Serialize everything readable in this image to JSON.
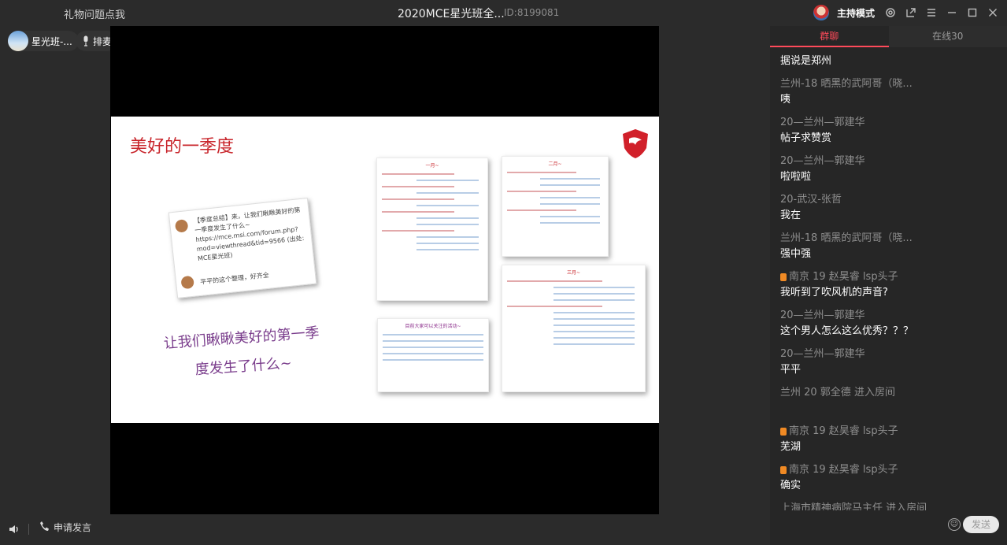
{
  "titlebar": {
    "gift_link": "礼物问题点我",
    "title": "2020MCE星光班全...",
    "room_id": "ID:8199081",
    "host_mode": "主持模式"
  },
  "stage": {
    "owner_name": "星光班-...",
    "mic_label": "排麦",
    "apply_label": "申请发言"
  },
  "slide": {
    "title": "美好的一季度",
    "note_text": "【季度总结】来，让我们瞅瞅美好的第一季度发生了什么~ https://mce.msi.com/forum.php?mod=viewthread&tid=9566 (出处: MCE星光班)",
    "note_sign": "平平的这个整理，好齐全",
    "purple_text": "让我们瞅瞅美好的第一季度发生了什么~",
    "card_month1": "一月~",
    "card_month2": "二月~",
    "card_month3": "三月~",
    "card_events": "目前大家可以关注的活动~"
  },
  "panel": {
    "tab_chat": "群聊",
    "tab_online": "在线30",
    "messages": [
      {
        "user": "",
        "text": "据说是郑州",
        "medal": false
      },
      {
        "user": "兰州-18 晒黑的武阿哥（晓...",
        "text": "咦",
        "medal": false
      },
      {
        "user": "20—兰州—郭建华",
        "text": "帖子求赞赏",
        "medal": false
      },
      {
        "user": "20—兰州—郭建华",
        "text": "啦啦啦",
        "medal": false
      },
      {
        "user": "20-武汉-张哲",
        "text": "我在",
        "medal": false
      },
      {
        "user": "兰州-18 晒黑的武阿哥（晓...",
        "text": "强中强",
        "medal": false
      },
      {
        "user": "南京 19 赵昊睿 lsp头子",
        "text": "我听到了吹风机的声音?",
        "medal": true
      },
      {
        "user": "20—兰州—郭建华",
        "text": "这个男人怎么这么优秀？？？",
        "medal": false
      },
      {
        "user": "20—兰州—郭建华",
        "text": "平平",
        "medal": false
      }
    ],
    "system1": "兰州  20  郭全德 进入房间",
    "messages2": [
      {
        "user": "南京 19 赵昊睿 lsp头子",
        "text": "芜湖",
        "medal": true
      },
      {
        "user": "南京 19 赵昊睿 lsp头子",
        "text": "确实",
        "medal": true
      }
    ],
    "system2": "上海市精神病院马主任 进入房间",
    "send_label": "发送",
    "input_placeholder": ""
  }
}
